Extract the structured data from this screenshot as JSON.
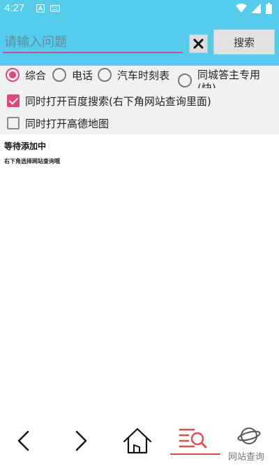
{
  "status_bar": {
    "time": "4:27"
  },
  "search": {
    "placeholder": "请输入问题",
    "button_label": "搜索"
  },
  "radio_options": [
    {
      "label": "综合",
      "checked": true
    },
    {
      "label": "电话",
      "checked": false
    },
    {
      "label": "汽车时刻表",
      "checked": false
    },
    {
      "label": "同城答主专用(快)",
      "checked": false
    }
  ],
  "checkboxes": [
    {
      "label": "同时打开百度搜索(右下角网站查询里面)",
      "checked": true
    },
    {
      "label": "同时打开高德地图",
      "checked": false
    }
  ],
  "status": {
    "title": "等待添加中",
    "hint": "右下角选择网站查询哦"
  },
  "bottom_nav": {
    "web_query_label": "网站查询"
  },
  "colors": {
    "header": "#56ccec",
    "accent": "#e0457b",
    "nav_active": "#e05050"
  }
}
